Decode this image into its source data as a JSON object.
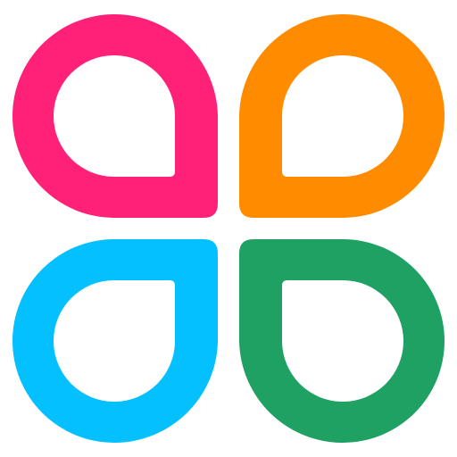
{
  "logo": {
    "name": "four-petal-logo",
    "petals": [
      {
        "position": "top-left",
        "color": "#FF2178"
      },
      {
        "position": "top-right",
        "color": "#FF8C00"
      },
      {
        "position": "bottom-left",
        "color": "#04C0FF"
      },
      {
        "position": "bottom-right",
        "color": "#1FA163"
      }
    ],
    "background": "#FFFFFF"
  }
}
